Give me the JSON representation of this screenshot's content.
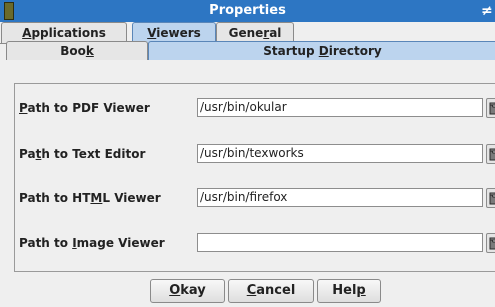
{
  "window": {
    "title": "Properties",
    "close_glyph": "≠"
  },
  "tabs_top": [
    {
      "label_pre": "",
      "label_key": "A",
      "label_post": "pplications"
    },
    {
      "label_pre": "",
      "label_key": "V",
      "label_post": "iewers"
    },
    {
      "label_pre": "Gene",
      "label_key": "r",
      "label_post": "al"
    }
  ],
  "tabs_sub": [
    {
      "label_pre": "Boo",
      "label_key": "k",
      "label_post": ""
    },
    {
      "label_pre": "Startup ",
      "label_key": "D",
      "label_post": "irectory"
    }
  ],
  "rows": [
    {
      "label_pre": "",
      "label_key": "P",
      "label_post": "ath to PDF Viewer",
      "value": "/usr/bin/okular"
    },
    {
      "label_pre": "Pa",
      "label_key": "t",
      "label_post": "h to Text Editor",
      "value": "/usr/bin/texworks"
    },
    {
      "label_pre": "Path to HT",
      "label_key": "M",
      "label_post": "L Viewer",
      "value": "/usr/bin/firefox"
    },
    {
      "label_pre": "Path to ",
      "label_key": "I",
      "label_post": "mage Viewer",
      "value": ""
    }
  ],
  "buttons": {
    "okay": {
      "label_pre": "",
      "label_key": "O",
      "label_post": "kay"
    },
    "cancel": {
      "label_pre": "",
      "label_key": "C",
      "label_post": "ancel"
    },
    "help": {
      "label_pre": "Hel",
      "label_key": "p",
      "label_post": ""
    }
  },
  "icons": {
    "browse": "folder-icon",
    "window": "window-menu-icon"
  },
  "colors": {
    "titlebar": "#2d76c3",
    "active_tab": "#bcd4ee"
  }
}
